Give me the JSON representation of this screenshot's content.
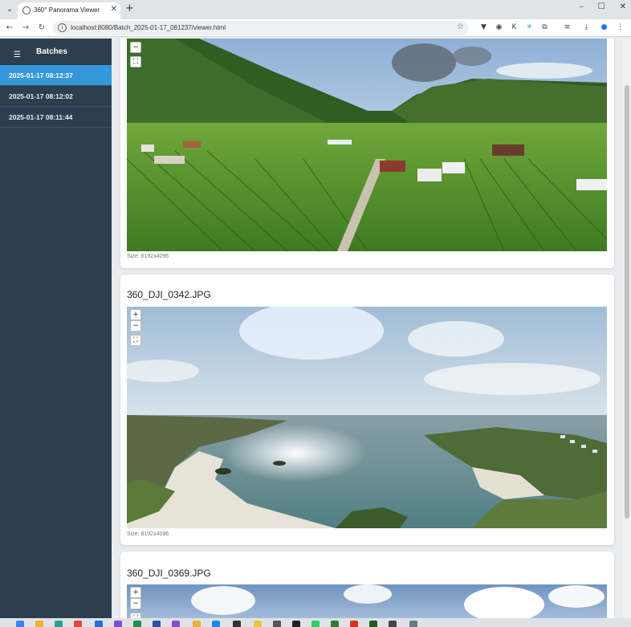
{
  "browser": {
    "tab_title": "360° Panorama Viewer",
    "url": "localhost:8080/Batch_2025-01-17_081237/viewer.html"
  },
  "sidebar": {
    "title": "Batches",
    "items": [
      {
        "label": "2025-01-17 08:12:37",
        "active": true
      },
      {
        "label": "2025-01-17 08:12:02",
        "active": false
      },
      {
        "label": "2025-01-17 08:11:44",
        "active": false
      }
    ]
  },
  "panoramas": [
    {
      "title": "",
      "size_text": "Size: 8192x4096",
      "scene": "vineyard-valley"
    },
    {
      "title": "360_DJI_0342.JPG",
      "size_text": "Size: 8192x4096",
      "scene": "coastal-bay"
    },
    {
      "title": "360_DJI_0369.JPG",
      "size_text": "",
      "scene": "sky-clouds"
    }
  ],
  "controls": {
    "zoom_in": "+",
    "zoom_out": "−",
    "fullscreen": "⛶"
  },
  "colors": {
    "sidebar_bg": "#2c3e50",
    "sidebar_active": "#3498db",
    "page_bg": "#e9ebee"
  }
}
